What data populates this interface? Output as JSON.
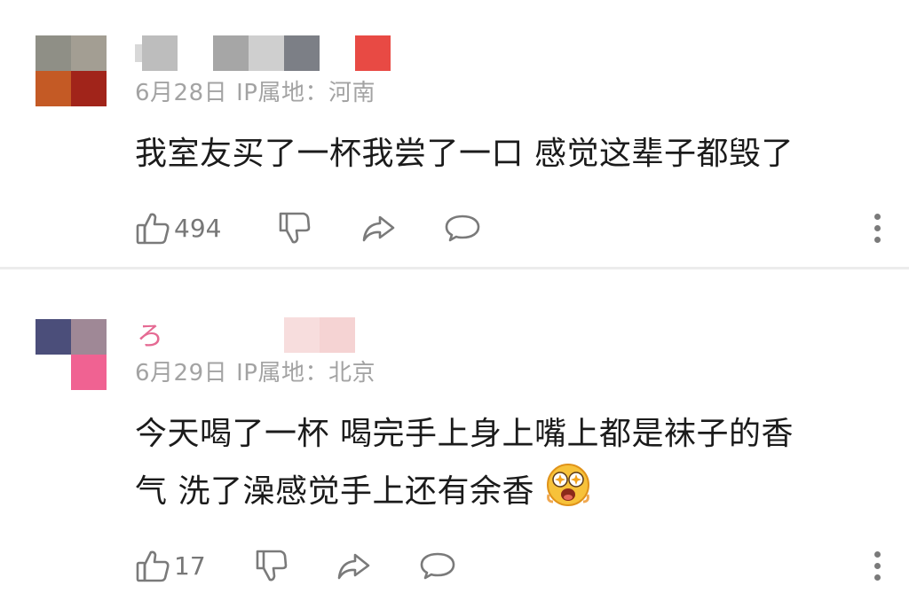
{
  "comments": [
    {
      "avatar_colors": [
        "#8f8f86",
        "#a39e93",
        "#c45a25",
        "#a1241a"
      ],
      "username_colors": [
        "#bdbdbd",
        "#a6a6a6",
        "#cfcfcf",
        "#7c7f86",
        "#e84a44"
      ],
      "date": "6月28日",
      "ip_location": "IP属地：河南",
      "text": "我室友买了一杯我尝了一口 感觉这辈子都毁了",
      "like_count": "494",
      "icons": [
        "thumbs-up-icon",
        "thumbs-down-icon",
        "share-icon",
        "reply-icon",
        "more-icon"
      ]
    },
    {
      "avatar_colors": [
        "#4b4e7a",
        "#9f8896",
        "#ffffff",
        "#f06292"
      ],
      "username_glyph": "ろ",
      "username_colors": [
        "#f2c7c7",
        "#f5d3d3"
      ],
      "date": "6月29日",
      "ip_location": "IP属地：北京",
      "text_line1": "今天喝了一杯 喝完手上身上嘴上都是袜子的香",
      "text_line2": "气 洗了澡感觉手上还有余香",
      "emoji": "star-eyes-emoji",
      "like_count": "17",
      "icons": [
        "thumbs-up-icon",
        "thumbs-down-icon",
        "share-icon",
        "reply-icon",
        "more-icon"
      ]
    }
  ],
  "colors": {
    "text": "#1b1b1b",
    "meta": "#a3a3a3",
    "icon": "#7a7a7a",
    "divider": "#ececec"
  }
}
